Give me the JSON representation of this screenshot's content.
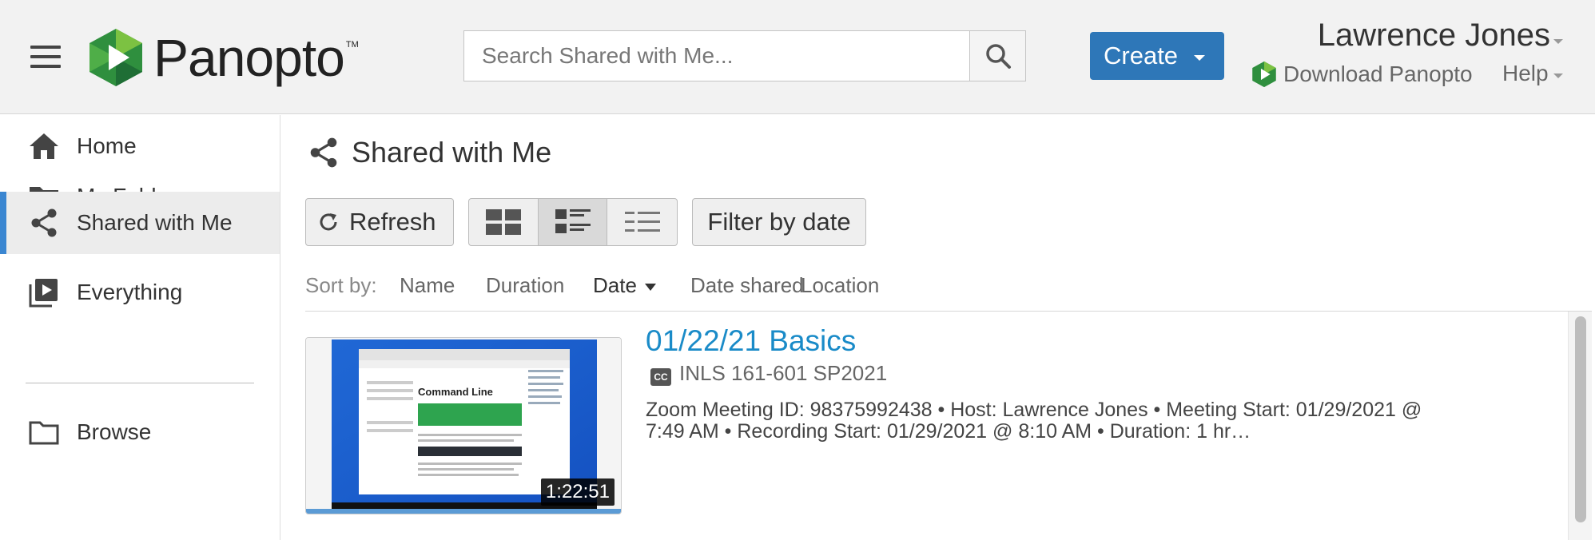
{
  "header": {
    "logo_text": "Panopto",
    "logo_tm": "TM",
    "search_placeholder": "Search Shared with Me...",
    "create_label": "Create",
    "user_name": "Lawrence Jones",
    "download_label": "Download Panopto",
    "help_label": "Help"
  },
  "sidebar": {
    "items": [
      {
        "label": "Home",
        "icon": "home-icon"
      },
      {
        "label": "My Folder",
        "icon": "folder-star-icon"
      },
      {
        "label": "Shared with Me",
        "icon": "share-icon",
        "active": true
      },
      {
        "label": "Everything",
        "icon": "video-library-icon"
      },
      {
        "label": "Browse",
        "icon": "folder-icon"
      }
    ]
  },
  "main": {
    "title": "Shared with Me",
    "refresh_label": "Refresh",
    "filter_label": "Filter by date",
    "view_modes": [
      "grid",
      "detail",
      "list"
    ],
    "selected_view": "detail",
    "sort": {
      "label": "Sort by:",
      "options": [
        "Name",
        "Duration",
        "Date",
        "Date shared",
        "Location"
      ],
      "active": "Date"
    },
    "sessions": [
      {
        "title": "01/22/21 Basics",
        "folder": "INLS 161-601 SP2021",
        "duration": "1:22:51",
        "description": "Zoom Meeting ID: 98375992438   • Host: Lawrence Jones   • Meeting Start: 01/29/2021 @ 7:49 AM   • Recording Start: 01/29/2021 @ 8:10 AM   • Duration: 1 hr…",
        "thumbnail_heading": "Command Line"
      }
    ]
  },
  "colors": {
    "accent": "#2e77b8",
    "link": "#1a8bc8",
    "active_indicator": "#3a86d1",
    "logo_green": "#3aa04a"
  }
}
